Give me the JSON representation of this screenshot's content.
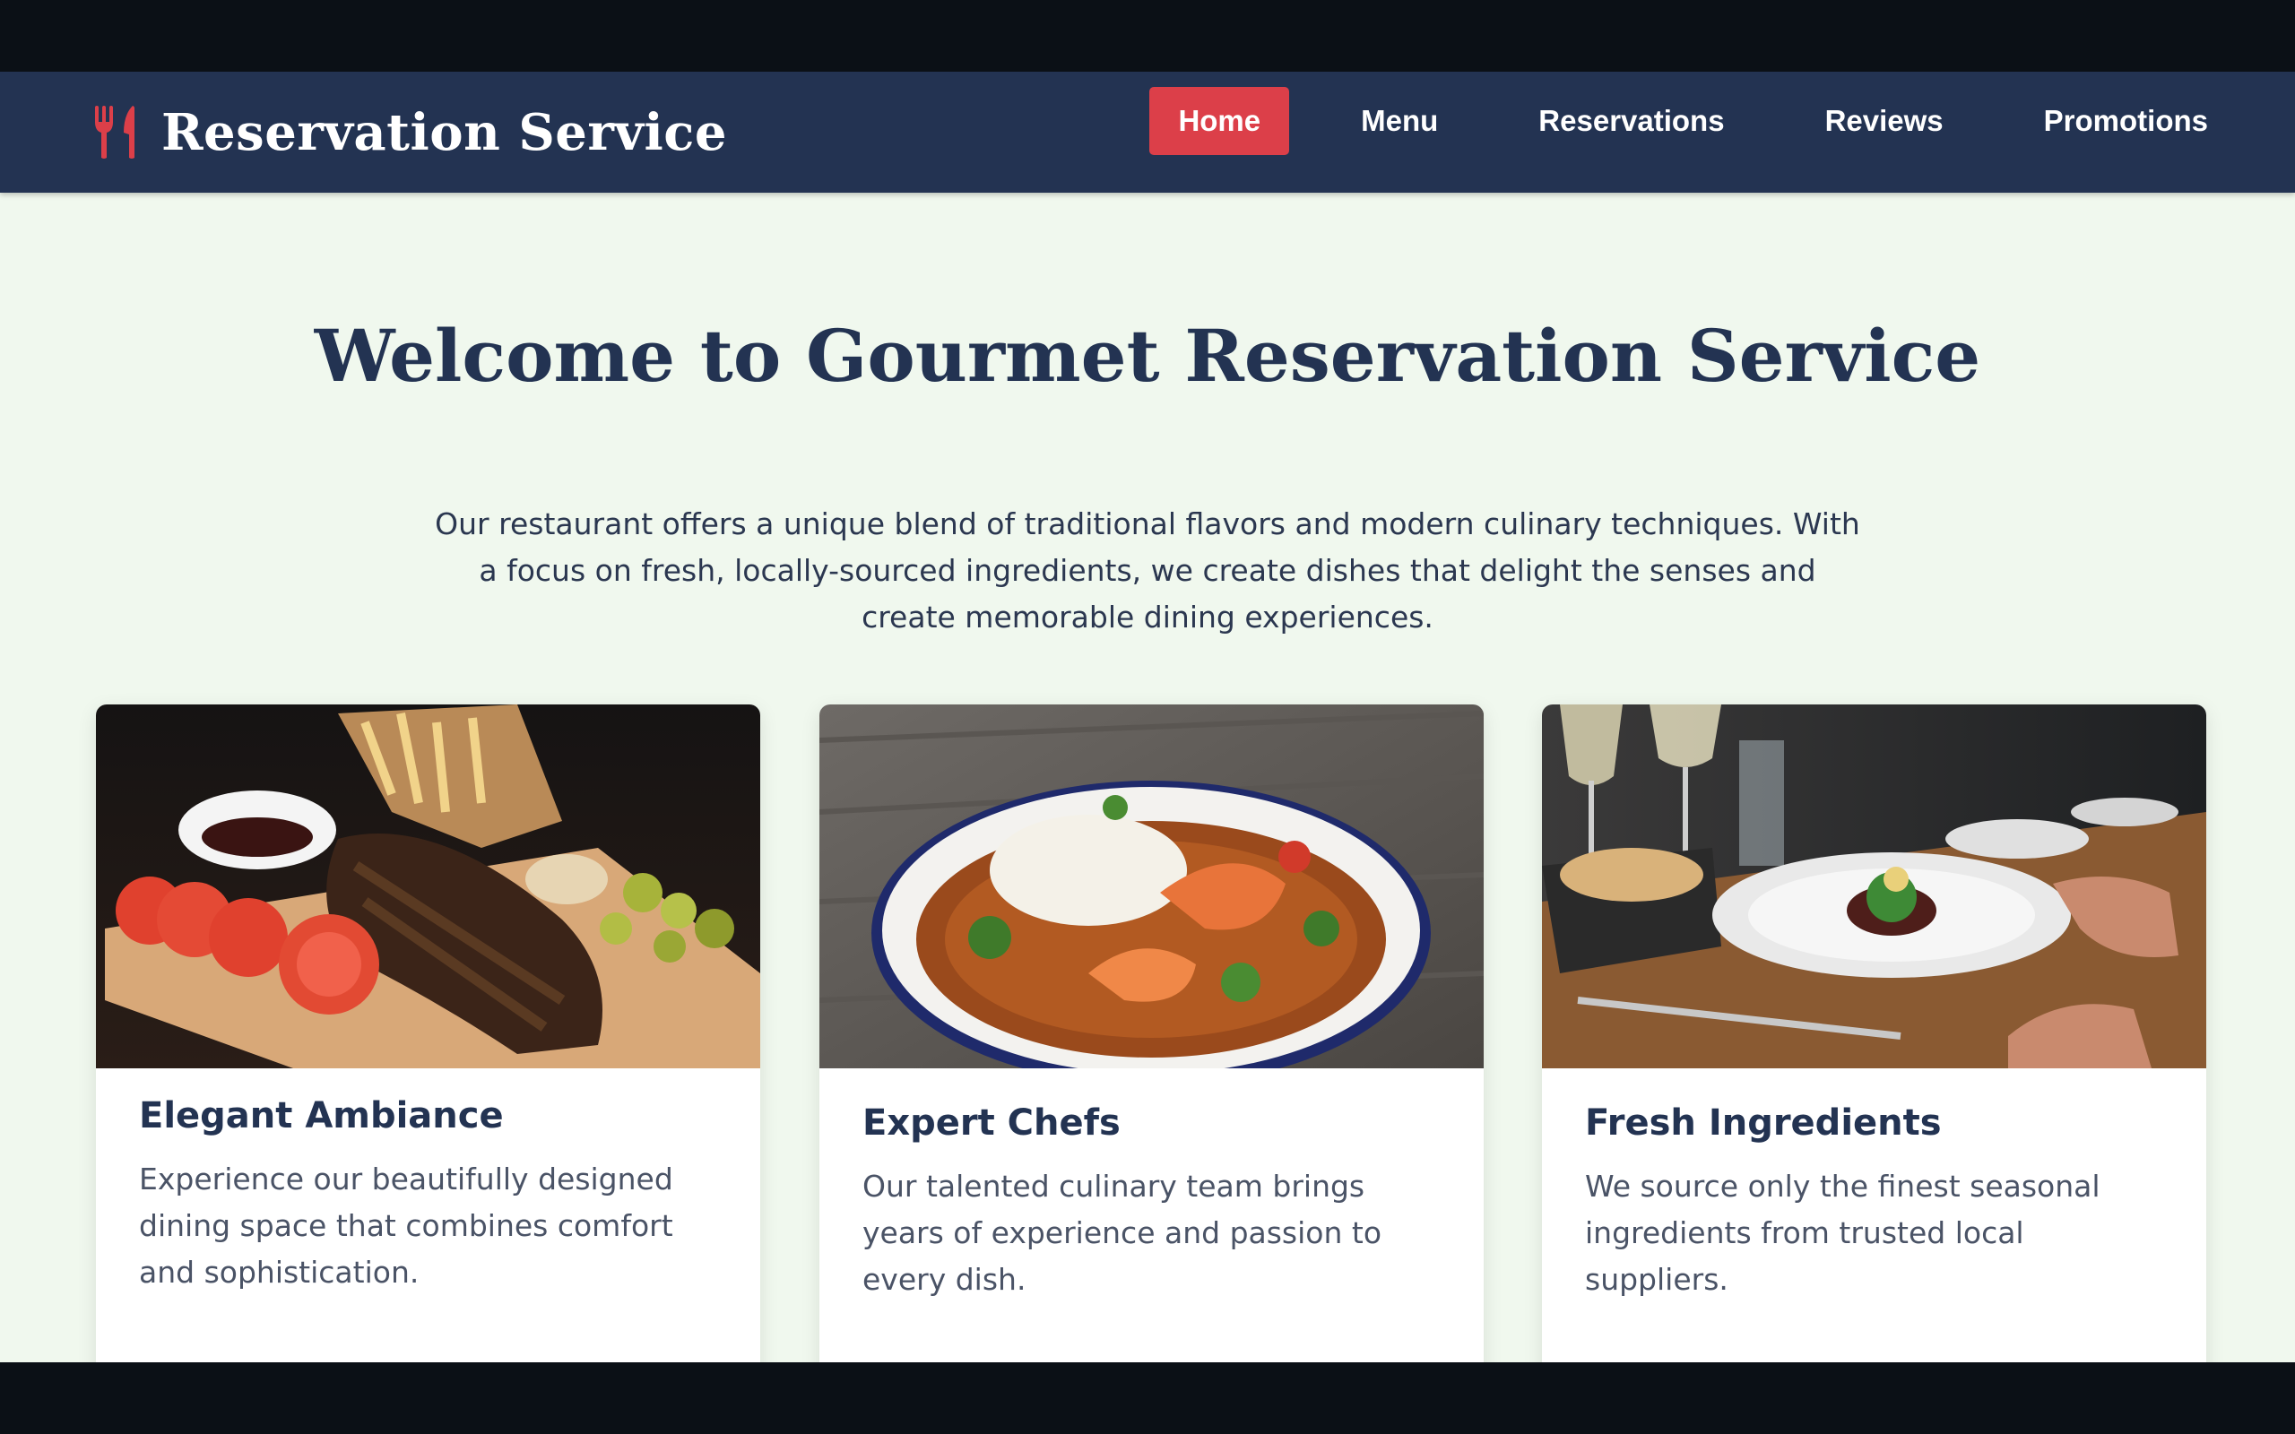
{
  "brand": {
    "title": "Reservation Service",
    "icon": "utensils-icon",
    "accent_color": "#dc3f49"
  },
  "nav": {
    "items": [
      {
        "label": "Home",
        "active": true
      },
      {
        "label": "Menu",
        "active": false
      },
      {
        "label": "Reservations",
        "active": false
      },
      {
        "label": "Reviews",
        "active": false
      },
      {
        "label": "Promotions",
        "active": false
      }
    ],
    "background_color": "#233352",
    "active_color": "#dc3f49"
  },
  "hero": {
    "title": "Welcome to Gourmet Reservation Service",
    "description": "Our restaurant offers a unique blend of traditional flavors and modern culinary techniques. With a focus on fresh, locally-sourced ingredients, we create dishes that delight the senses and create memorable dining experiences."
  },
  "features": [
    {
      "image": "grilled-ribs-platter-photo",
      "title": "Elegant Ambiance",
      "text": "Experience our beautifully designed dining space that combines comfort and sophistication."
    },
    {
      "image": "shrimp-curry-bowl-photo",
      "title": "Expert Chefs",
      "text": "Our talented culinary team brings years of experience and passion to every dish."
    },
    {
      "image": "fine-dining-table-photo",
      "title": "Fresh Ingredients",
      "text": "We source only the finest seasonal ingredients from trusted local suppliers."
    }
  ],
  "page_background_color": "#f0f8ee"
}
